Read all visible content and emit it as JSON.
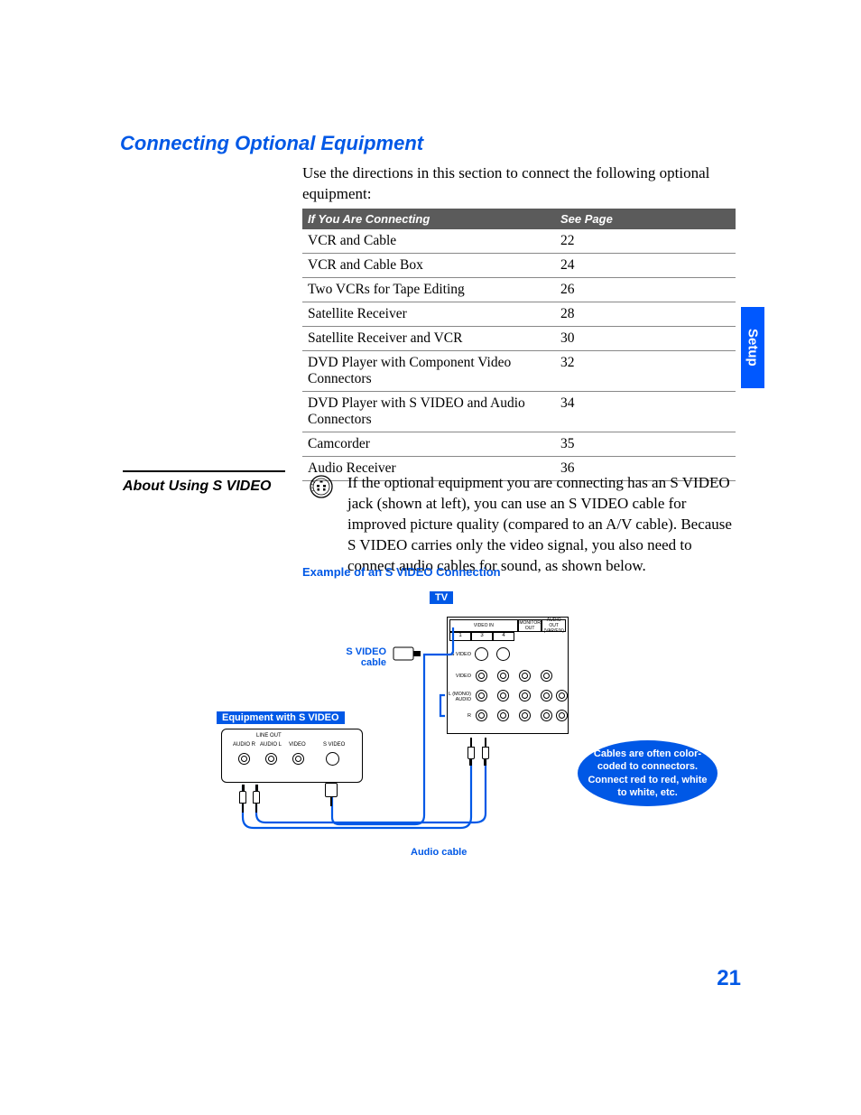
{
  "title": "Connecting Optional Equipment",
  "intro": "Use the directions in this section to connect the following optional equipment:",
  "table": {
    "head": {
      "col1": "If You Are Connecting",
      "col2": "See Page"
    },
    "rows": [
      {
        "item": "VCR and Cable",
        "page": "22"
      },
      {
        "item": "VCR and Cable Box",
        "page": "24"
      },
      {
        "item": "Two VCRs for Tape Editing",
        "page": "26"
      },
      {
        "item": "Satellite Receiver",
        "page": "28"
      },
      {
        "item": "Satellite Receiver and VCR",
        "page": "30"
      },
      {
        "item": "DVD Player with Component Video Connectors",
        "page": "32"
      },
      {
        "item": "DVD Player with S VIDEO and Audio Connectors",
        "page": "34"
      },
      {
        "item": "Camcorder",
        "page": "35"
      },
      {
        "item": "Audio Receiver",
        "page": "36"
      }
    ]
  },
  "side_tab": "Setup",
  "about": {
    "heading": "About Using S VIDEO",
    "para": "If the optional equipment you are connecting has an S VIDEO jack (shown at left), you can use an S VIDEO cable for improved picture quality (compared to an A/V cable). Because S VIDEO carries only the video signal, you also need to connect audio cables for sound, as shown below."
  },
  "example_caption": "Example of an S VIDEO Connection",
  "diagram": {
    "tv": "TV",
    "svideo_cable": "S VIDEO cable",
    "equipment": "Equipment with S VIDEO",
    "audio_cable": "Audio cable",
    "tv_panel": {
      "video_in": "VIDEO IN",
      "monitor_out": "MONITOR OUT",
      "audio_out": "AUDIO OUT (VAR/FIX)",
      "n1": "1",
      "n3": "3",
      "n4": "4",
      "svideo": "S VIDEO",
      "video": "VIDEO",
      "l_mono": "L (MONO) AUDIO",
      "r": "R"
    },
    "equip_panel": {
      "line_out": "LINE OUT",
      "audio_r": "AUDIO R",
      "audio_l": "AUDIO L",
      "video": "VIDEO",
      "svideo": "S VIDEO"
    },
    "callout": "Cables are often color-coded to connectors. Connect red to red, white to white, etc."
  },
  "page_number": "21"
}
